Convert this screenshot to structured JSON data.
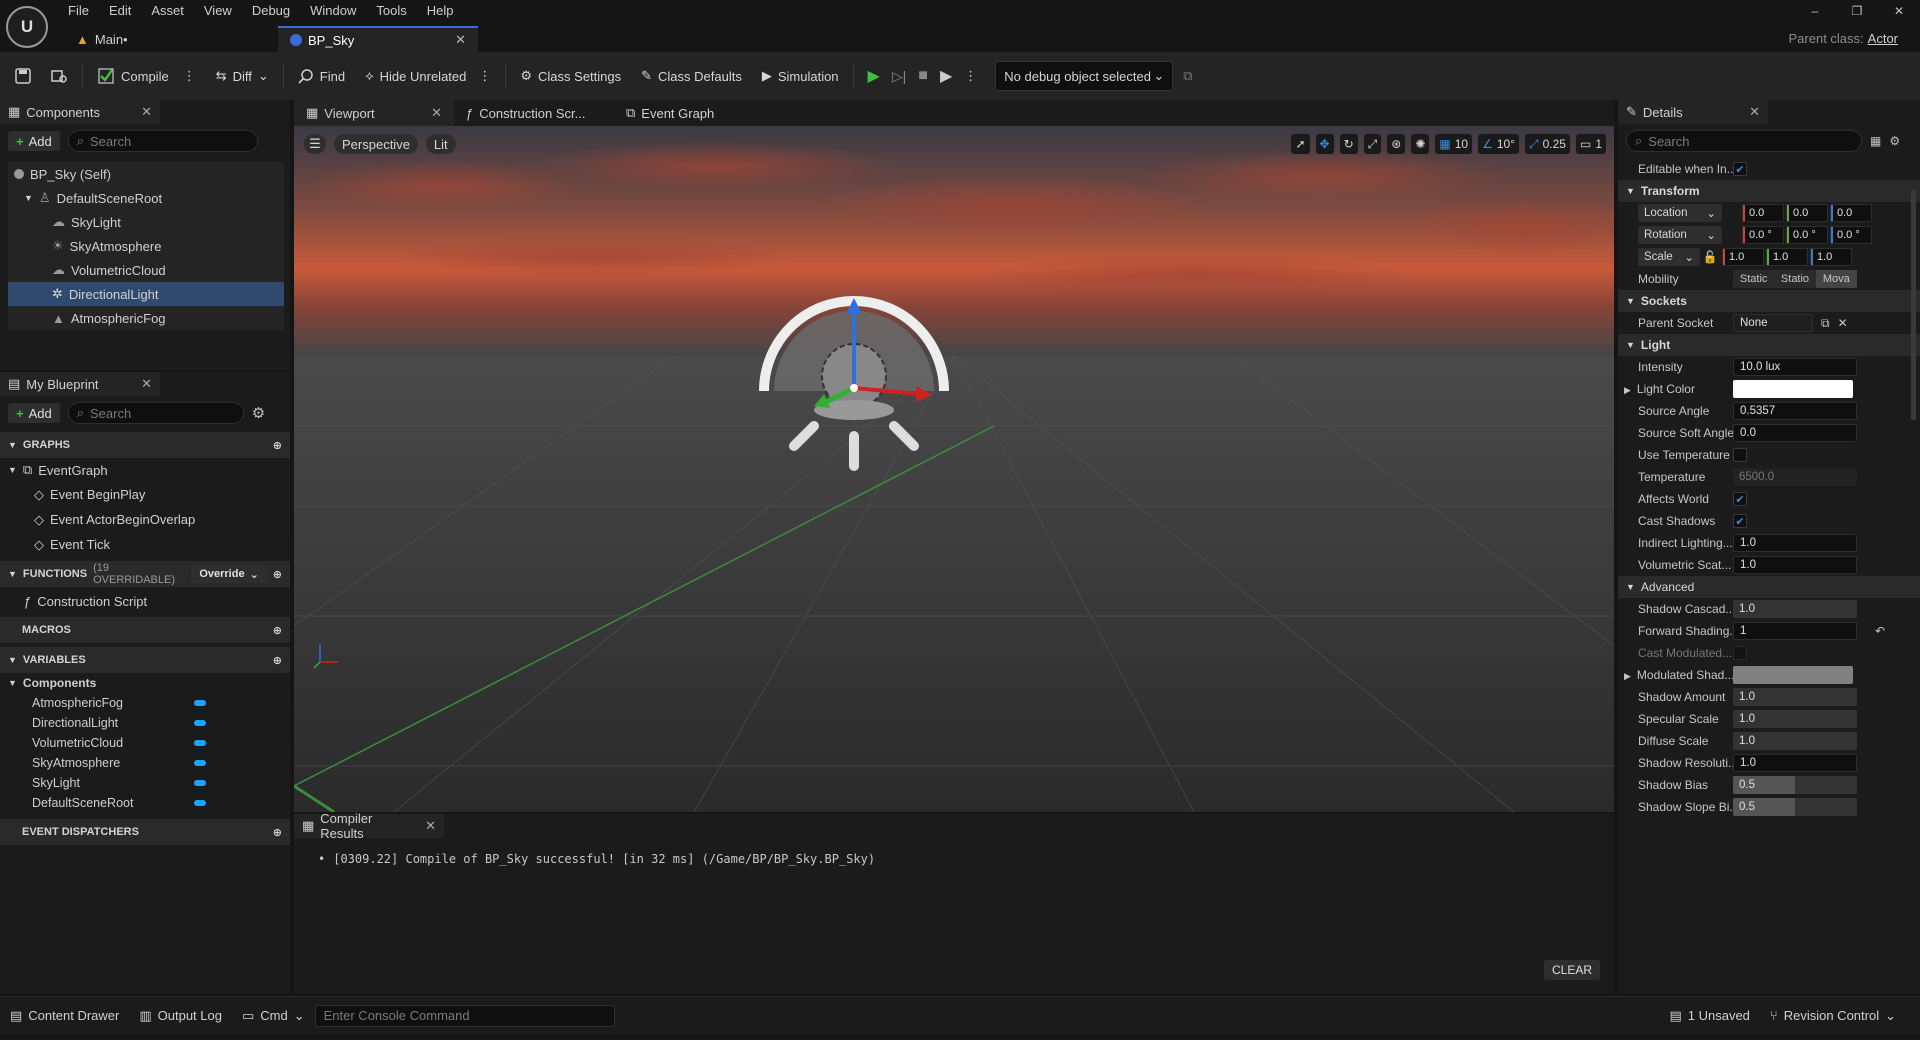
{
  "menu": [
    "File",
    "Edit",
    "Asset",
    "View",
    "Debug",
    "Window",
    "Tools",
    "Help"
  ],
  "tabs": {
    "main": "Main•",
    "bpsky": "BP_Sky"
  },
  "parent_class": {
    "label": "Parent class:",
    "value": "Actor"
  },
  "toolbar": {
    "compile": "Compile",
    "diff": "Diff",
    "find": "Find",
    "hide_unrelated": "Hide Unrelated",
    "class_settings": "Class Settings",
    "class_defaults": "Class Defaults",
    "simulation": "Simulation",
    "debug_object": "No debug object selected"
  },
  "components": {
    "title": "Components",
    "add": "Add",
    "search_placeholder": "Search",
    "items": [
      {
        "label": "BP_Sky (Self)"
      },
      {
        "label": "DefaultSceneRoot"
      },
      {
        "label": "SkyLight"
      },
      {
        "label": "SkyAtmosphere"
      },
      {
        "label": "VolumetricCloud"
      },
      {
        "label": "DirectionalLight"
      },
      {
        "label": "AtmosphericFog"
      }
    ]
  },
  "my_blueprint": {
    "title": "My Blueprint",
    "add": "Add",
    "search_placeholder": "Search",
    "graphs": "GRAPHS",
    "event_graph": "EventGraph",
    "events": [
      "Event BeginPlay",
      "Event ActorBeginOverlap",
      "Event Tick"
    ],
    "functions": "FUNCTIONS",
    "functions_count": "(19 OVERRIDABLE)",
    "override": "Override",
    "construction_script": "Construction Script",
    "macros": "MACROS",
    "variables": "VARIABLES",
    "components_group": "Components",
    "variable_items": [
      "AtmosphericFog",
      "DirectionalLight",
      "VolumetricCloud",
      "SkyAtmosphere",
      "SkyLight",
      "DefaultSceneRoot"
    ],
    "event_dispatchers": "EVENT DISPATCHERS"
  },
  "viewport": {
    "tabs": [
      "Viewport",
      "Construction Scr...",
      "Event Graph"
    ],
    "perspective": "Perspective",
    "lit": "Lit",
    "grid_snap": "10",
    "rot_snap": "10°",
    "scale_snap": "0.25",
    "camera_speed": "1"
  },
  "compiler": {
    "title": "Compiler Results",
    "message": "[0309.22] Compile of BP_Sky successful! [in 32 ms] (/Game/BP/BP_Sky.BP_Sky)",
    "clear": "CLEAR"
  },
  "details": {
    "title": "Details",
    "search_placeholder": "Search",
    "editable": "Editable when In...",
    "transform": "Transform",
    "location": {
      "label": "Location",
      "x": "0.0",
      "y": "0.0",
      "z": "0.0"
    },
    "rotation": {
      "label": "Rotation",
      "x": "0.0 °",
      "y": "0.0 °",
      "z": "0.0 °"
    },
    "scale": {
      "label": "Scale",
      "x": "1.0",
      "y": "1.0",
      "z": "1.0"
    },
    "mobility": {
      "label": "Mobility",
      "options": [
        "Static",
        "Statio",
        "Mova"
      ]
    },
    "sockets": "Sockets",
    "parent_socket": {
      "label": "Parent Socket",
      "value": "None"
    },
    "light": "Light",
    "intensity": {
      "label": "Intensity",
      "value": "10.0 lux"
    },
    "light_color": "Light Color",
    "source_angle": {
      "label": "Source Angle",
      "value": "0.5357"
    },
    "source_soft_angle": {
      "label": "Source Soft Angle",
      "value": "0.0"
    },
    "use_temperature": "Use Temperature",
    "temperature": {
      "label": "Temperature",
      "value": "6500.0"
    },
    "affects_world": "Affects World",
    "cast_shadows": "Cast Shadows",
    "indirect": {
      "label": "Indirect Lighting...",
      "value": "1.0"
    },
    "volumetric": {
      "label": "Volumetric Scat...",
      "value": "1.0"
    },
    "advanced": "Advanced",
    "shadow_cascade": {
      "label": "Shadow Cascad...",
      "value": "1.0"
    },
    "forward_shading": {
      "label": "Forward Shading...",
      "value": "1"
    },
    "cast_modulated": "Cast Modulated...",
    "modulated_shad": "Modulated Shad...",
    "shadow_amount": {
      "label": "Shadow Amount",
      "value": "1.0"
    },
    "specular_scale": {
      "label": "Specular Scale",
      "value": "1.0"
    },
    "diffuse_scale": {
      "label": "Diffuse Scale",
      "value": "1.0"
    },
    "shadow_resolution": {
      "label": "Shadow Resoluti...",
      "value": "1.0"
    },
    "shadow_bias": {
      "label": "Shadow Bias",
      "value": "0.5"
    },
    "shadow_slope": {
      "label": "Shadow Slope Bi...",
      "value": "0.5"
    }
  },
  "status": {
    "content_drawer": "Content Drawer",
    "output_log": "Output Log",
    "cmd": "Cmd",
    "console_placeholder": "Enter Console Command",
    "unsaved": "1 Unsaved",
    "revision": "Revision Control"
  },
  "colors": {
    "accent": "#3a6ed6",
    "selection": "#304a6e",
    "play": "#3fbf3f",
    "variable_pill": "#1fa3ff"
  }
}
